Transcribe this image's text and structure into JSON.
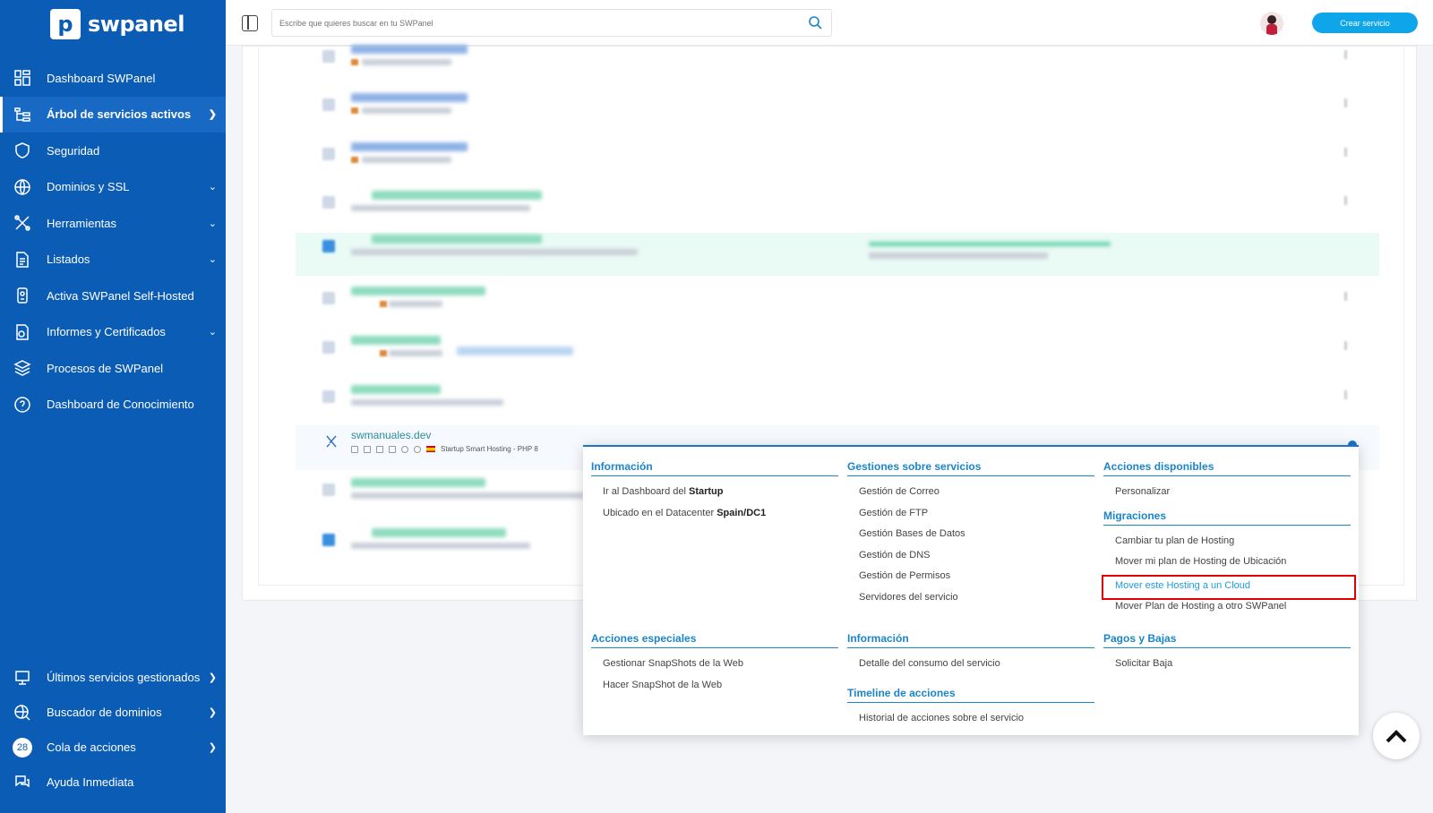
{
  "app": {
    "logo_text": "swpanel"
  },
  "sidebar": {
    "items": [
      {
        "label": "Dashboard SWPanel",
        "icon": "dashboard-icon"
      },
      {
        "label": "Árbol de servicios activos",
        "icon": "tree-icon",
        "active": true
      },
      {
        "label": "Seguridad",
        "icon": "shield-icon"
      },
      {
        "label": "Dominios y SSL",
        "icon": "www-icon"
      },
      {
        "label": "Herramientas",
        "icon": "tools-icon"
      },
      {
        "label": "Listados",
        "icon": "document-icon"
      },
      {
        "label": "Activa SWPanel Self-Hosted",
        "icon": "server-icon"
      },
      {
        "label": "Informes y Certificados",
        "icon": "report-icon"
      },
      {
        "label": "Procesos de SWPanel",
        "icon": "layers-icon"
      },
      {
        "label": "Dashboard de Conocimiento",
        "icon": "help-icon"
      }
    ],
    "bottom_items": [
      {
        "label": "Últimos servicios gestionados",
        "icon": "monitor-icon"
      },
      {
        "label": "Buscador de dominios",
        "icon": "globe-icon"
      },
      {
        "label": "Cola de acciones",
        "badge": "28"
      },
      {
        "label": "Ayuda Inmediata",
        "icon": "chat-icon"
      }
    ]
  },
  "header": {
    "search_placeholder": "Escribe que quieres buscar en tu SWPanel",
    "create_button": "Crear servicio"
  },
  "focus_service": {
    "domain": "swmanuales.dev",
    "plan": "Startup Smart Hosting - PHP 8"
  },
  "menu": {
    "col1": {
      "title": "Información",
      "items": [
        {
          "prefix": "Ir al Dashboard del ",
          "bold": "Startup"
        },
        {
          "prefix": "Ubicado en el Datacenter ",
          "bold": "Spain/DC1"
        }
      ],
      "title2": "Acciones especiales",
      "items2": [
        "Gestionar SnapShots de la Web",
        "Hacer SnapShot de la Web"
      ]
    },
    "col2": {
      "title": "Gestiones sobre servicios",
      "items": [
        "Gestión de Correo",
        "Gestión de FTP",
        "Gestión Bases de Datos",
        "Gestión de DNS",
        "Gestión de Permisos",
        "Servidores del servicio"
      ],
      "title2": "Información",
      "items2": [
        "Detalle del consumo del servicio"
      ],
      "title3": "Timeline de acciones",
      "items3": [
        "Historial de acciones sobre el servicio"
      ]
    },
    "col3": {
      "title": "Acciones disponibles",
      "items": [
        "Personalizar"
      ],
      "title2": "Migraciones",
      "items2": [
        "Cambiar tu plan de Hosting",
        "Mover mi plan de Hosting de Ubicación",
        "Mover este Hosting a un Cloud",
        "Mover Plan de Hosting a otro SWPanel"
      ],
      "title3": "Pagos y Bajas",
      "items3": [
        "Solicitar Baja"
      ]
    }
  },
  "colors": {
    "sidebar": "#0b5cb5",
    "accent": "#1a85c9",
    "highlight_border": "#e00000",
    "create_button": "#0ea5ea"
  }
}
